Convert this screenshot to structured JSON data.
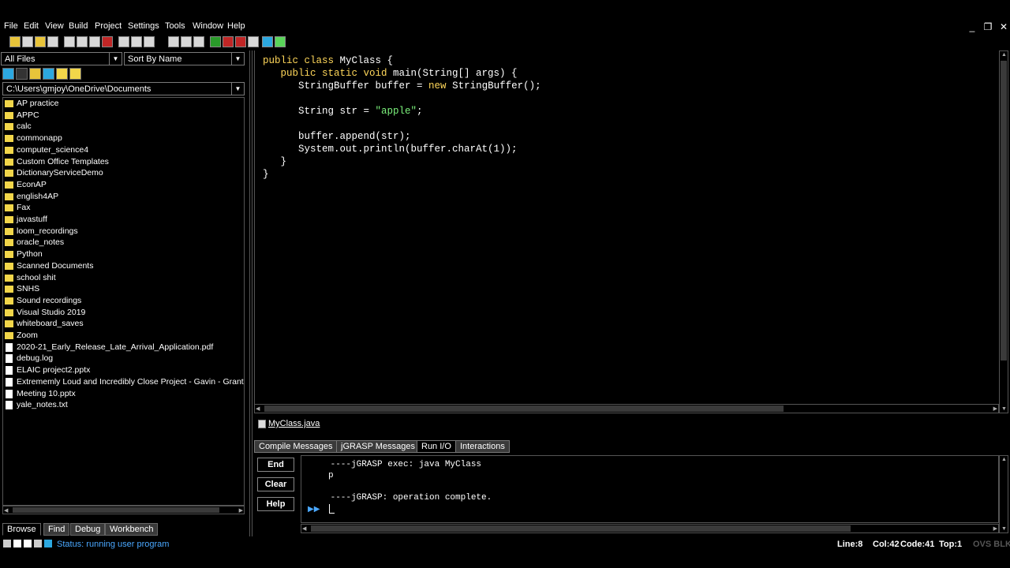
{
  "menu": [
    "File",
    "Edit",
    "View",
    "Build",
    "Project",
    "Settings",
    "Tools",
    "Window",
    "Help"
  ],
  "window_controls": {
    "minimize": "_",
    "restore": "❐",
    "close": "✕"
  },
  "browse": {
    "filter": "All Files",
    "sort": "Sort By Name",
    "path": "C:\\Users\\gmjoy\\OneDrive\\Documents",
    "folders": [
      "AP practice",
      "APPC",
      "calc",
      "commonapp",
      "computer_science4",
      "Custom Office Templates",
      "DictionaryServiceDemo",
      "EconAP",
      "english4AP",
      "Fax",
      "javastuff",
      "loom_recordings",
      "oracle_notes",
      "Python",
      "Scanned Documents",
      "school shit",
      "SNHS",
      "Sound recordings",
      "Visual Studio 2019",
      "whiteboard_saves",
      "Zoom"
    ],
    "files": [
      "2020-21_Early_Release_Late_Arrival_Application.pdf",
      "debug.log",
      "ELAIC project2.pptx",
      "Extrememly Loud and Incredibly Close Project - Gavin - Grant",
      "Meeting 10.pptx",
      "yale_notes.txt"
    ],
    "tabs": [
      "Browse",
      "Find",
      "Debug",
      "Workbench"
    ]
  },
  "editor": {
    "code_lines": [
      [
        {
          "t": "public class ",
          "c": "kw"
        },
        {
          "t": "MyClass {",
          "c": ""
        }
      ],
      [
        {
          "t": "   public static void ",
          "c": "kw"
        },
        {
          "t": "main(String[] args) {",
          "c": ""
        }
      ],
      [
        {
          "t": "      StringBuffer buffer = ",
          "c": ""
        },
        {
          "t": "new ",
          "c": "kw"
        },
        {
          "t": "StringBuffer();",
          "c": ""
        }
      ],
      [
        {
          "t": "",
          "c": ""
        }
      ],
      [
        {
          "t": "      String str = ",
          "c": ""
        },
        {
          "t": "\"apple\"",
          "c": "str"
        },
        {
          "t": ";",
          "c": ""
        }
      ],
      [
        {
          "t": "",
          "c": ""
        }
      ],
      [
        {
          "t": "      buffer.append(str);",
          "c": ""
        }
      ],
      [
        {
          "t": "      System.out.println(buffer.charAt(1));",
          "c": ""
        }
      ],
      [
        {
          "t": "   }",
          "c": ""
        }
      ],
      [
        {
          "t": "}",
          "c": ""
        }
      ]
    ],
    "file_tab": "MyClass.java"
  },
  "messages": {
    "tabs": [
      "Compile Messages",
      "jGRASP Messages",
      "Run I/O",
      "Interactions"
    ],
    "active_tab": "Run I/O",
    "buttons": [
      "End",
      "Clear",
      "Help"
    ],
    "output_lines": [
      " ----jGRASP exec: java MyClass",
      "p",
      "",
      " ----jGRASP: operation complete."
    ],
    "prompt": "▶▶"
  },
  "status": {
    "text": "Status: running user program",
    "line": "Line:8",
    "col": "Col:42",
    "code": "Code:41",
    "top": "Top:1",
    "mode": "OVS BLK"
  }
}
